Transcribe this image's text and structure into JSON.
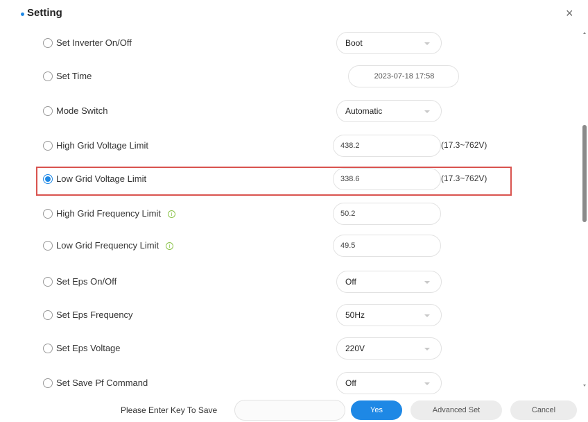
{
  "header": {
    "title": "Setting",
    "close_glyph": "×"
  },
  "rows": [
    {
      "label": "Set Inverter On/Off",
      "control": "select",
      "value": "Boot",
      "checked": false,
      "info": false
    },
    {
      "label": "Set Time",
      "control": "time",
      "value": "2023-07-18 17:58",
      "checked": false,
      "info": false
    },
    {
      "label": "Mode Switch",
      "control": "select",
      "value": "Automatic",
      "checked": false,
      "info": false
    },
    {
      "label": "High Grid Voltage Limit",
      "control": "input",
      "value": "438.2",
      "range": "(17.3~762V)",
      "checked": false,
      "info": false
    },
    {
      "label": "Low Grid Voltage Limit",
      "control": "input",
      "value": "338.6",
      "range": "(17.3~762V)",
      "checked": true,
      "info": false
    },
    {
      "label": "High Grid Frequency Limit",
      "control": "input",
      "value": "50.2",
      "checked": false,
      "info": true
    },
    {
      "label": "Low Grid Frequency Limit",
      "control": "input",
      "value": "49.5",
      "checked": false,
      "info": true
    },
    {
      "label": "Set Eps On/Off",
      "control": "select",
      "value": "Off",
      "checked": false,
      "info": false
    },
    {
      "label": "Set Eps Frequency",
      "control": "select",
      "value": "50Hz",
      "checked": false,
      "info": false
    },
    {
      "label": "Set Eps Voltage",
      "control": "select",
      "value": "220V",
      "checked": false,
      "info": false
    },
    {
      "label": "Set Save Pf Command",
      "control": "select",
      "value": "Off",
      "checked": false,
      "info": false
    }
  ],
  "footer": {
    "key_label": "Please Enter Key To Save",
    "key_value": "",
    "yes_label": "Yes",
    "advanced_label": "Advanced Set",
    "cancel_label": "Cancel"
  },
  "colors": {
    "accent": "#1e88e5",
    "highlight": "#d9534f",
    "info": "#8bc34a"
  },
  "icons": {
    "info": "info-icon",
    "dropdown": "chevron-down-icon",
    "close": "close-icon"
  }
}
